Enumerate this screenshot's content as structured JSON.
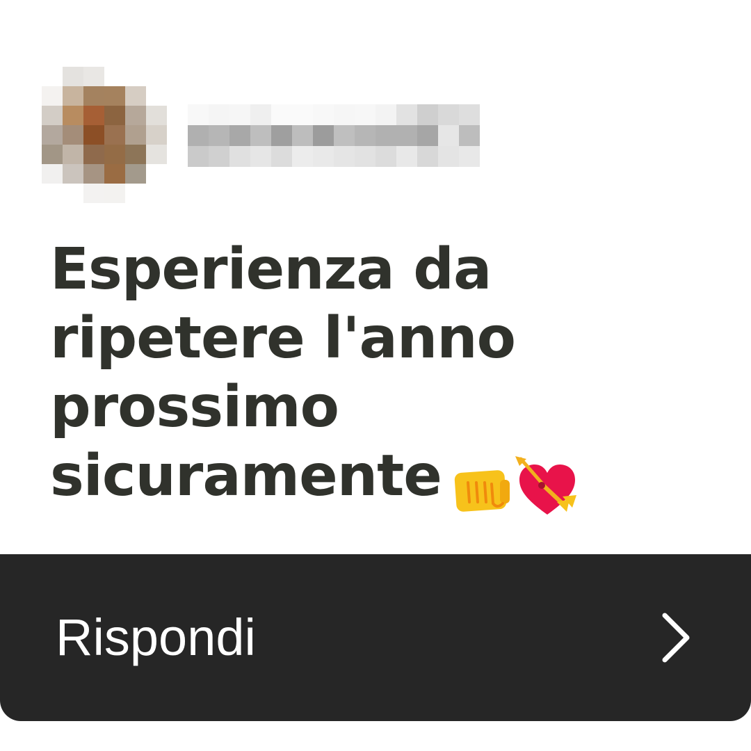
{
  "post": {
    "avatar_label": "",
    "username": "",
    "message_lines": [
      "Esperienza da",
      "ripetere l'anno",
      "prossimo",
      "sicuramente"
    ],
    "emoji_icons": [
      "oncoming-fist-icon",
      "heart-with-arrow-icon"
    ]
  },
  "reply": {
    "label": "Rispondi",
    "icon": "chevron-right-icon"
  },
  "colors": {
    "text": "#30322c",
    "bar": "#262626",
    "bar_text": "#ffffff",
    "heart": "#e8134a",
    "fist": "#f7c21b"
  }
}
